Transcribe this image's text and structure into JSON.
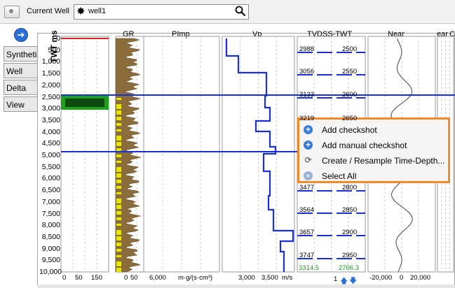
{
  "header": {
    "current_well_label": "Current Well",
    "well_value": "well1"
  },
  "tabs": [
    "Synthetic",
    "Well",
    "Delta",
    "View"
  ],
  "track_headers": {
    "gr": "GR",
    "pimp": "PImp",
    "vp": "Vp",
    "tvdss": "TVDSS-TWT",
    "near": "Near",
    "ear": "ear",
    "c": "C"
  },
  "axis_label": "TWT ms",
  "twt_ticks": [
    "0",
    "500",
    "1,000",
    "1,500",
    "2,000",
    "2,500",
    "3,000",
    "3,500",
    "4,000",
    "4,500",
    "5,000",
    "5,500",
    "6,000",
    "6,500",
    "7,000",
    "7,500",
    "8,000",
    "8,500",
    "9,000",
    "9,500",
    "10,000"
  ],
  "gr_axis": [
    "0",
    "50",
    "150"
  ],
  "pimp_axis": [
    "6,000",
    "m·g/(s·cm³)"
  ],
  "vp_axis": [
    "3,000",
    "3,500",
    "m/s"
  ],
  "near_axis": [
    "-20,000",
    "0",
    "20,000"
  ],
  "tvdss_rows": [
    [
      "2988",
      "2500"
    ],
    [
      "3056",
      "2550"
    ],
    [
      "3133",
      "2600"
    ],
    [
      "3219",
      "2650"
    ],
    [
      "3477",
      "2800"
    ],
    [
      "3564",
      "2850"
    ],
    [
      "3657",
      "2900"
    ],
    [
      "3747",
      "2950"
    ]
  ],
  "tvdss_footer": [
    "3314.5",
    "2706.3"
  ],
  "tvdss_page": "1",
  "context_menu": [
    "Add checkshot",
    "Add manual checkshot",
    "Create / Resample Time-Depth...",
    "Select All"
  ]
}
